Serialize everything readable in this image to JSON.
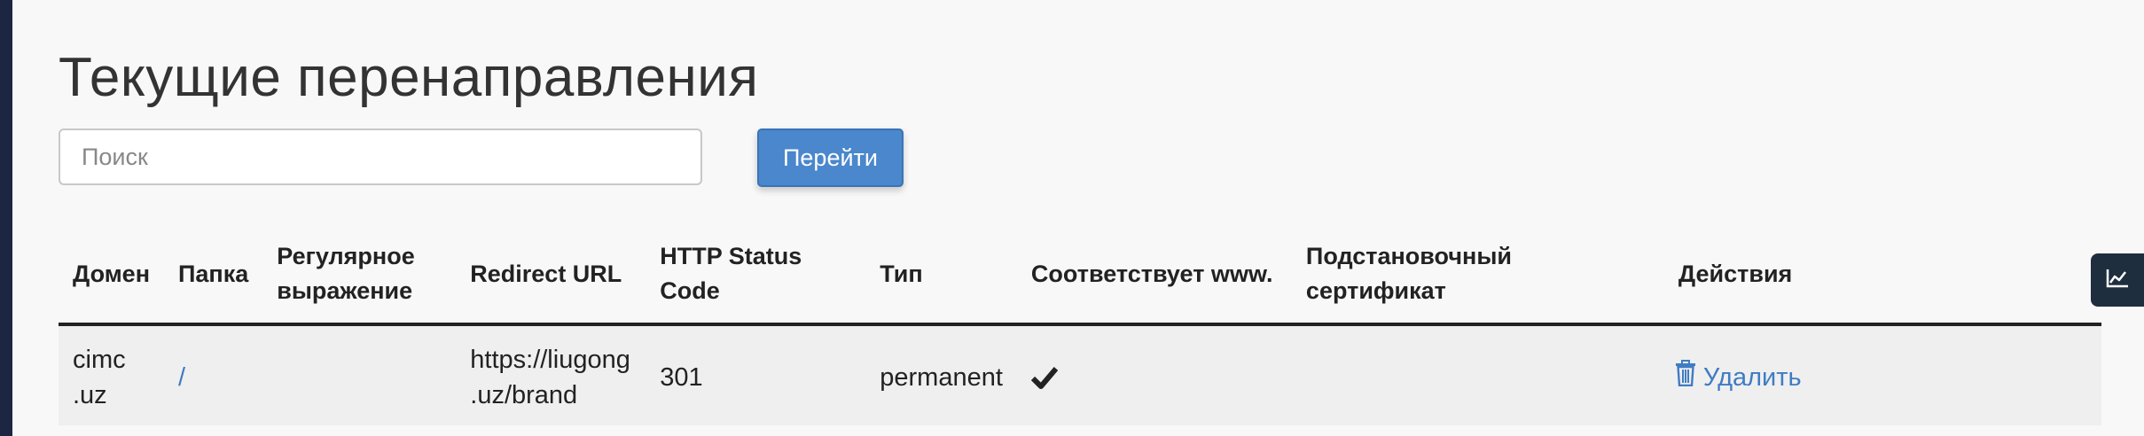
{
  "page": {
    "title": "Текущие перенаправления"
  },
  "search": {
    "placeholder": "Поиск",
    "value": "",
    "button_label": "Перейти"
  },
  "table": {
    "columns": [
      "Домен",
      "Папка",
      "Регулярное выражение",
      "Redirect URL",
      "HTTP Status Code",
      "Тип",
      "Соответствует www.",
      "Подстановочный сертификат",
      "Действия"
    ],
    "rows": [
      {
        "domain": "cimc .uz",
        "folder": "/",
        "regex": "",
        "redirect_url": "https://liugong .uz/brand",
        "status_code": "301",
        "type": "permanent",
        "matches_www": true,
        "wildcard": "",
        "action_label": "Удалить"
      }
    ]
  },
  "icons": {
    "check": "check-icon",
    "trash": "trash-icon",
    "stats": "chart-icon"
  },
  "colors": {
    "accent": "#4a87cc",
    "link": "#3f7cc4",
    "rail": "#1c2541",
    "side_tab": "#1f2e3f"
  }
}
